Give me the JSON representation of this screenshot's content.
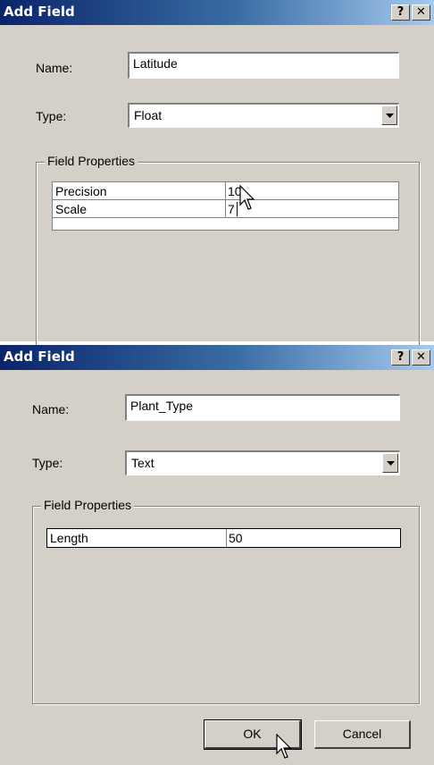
{
  "dialogs": [
    {
      "title": "Add Field",
      "help_label": "?",
      "close_label": "✕",
      "name_label": "Name:",
      "name_value": "Latitude",
      "type_label": "Type:",
      "type_value": "Float",
      "group_title": "Field Properties",
      "properties": [
        {
          "name": "Precision",
          "value": "10"
        },
        {
          "name": "Scale",
          "value": "7"
        }
      ]
    },
    {
      "title": "Add Field",
      "help_label": "?",
      "close_label": "✕",
      "name_label": "Name:",
      "name_value": "Plant_Type",
      "type_label": "Type:",
      "type_value": "Text",
      "group_title": "Field Properties",
      "properties": [
        {
          "name": "Length",
          "value": "50"
        }
      ],
      "ok_label": "OK",
      "cancel_label": "Cancel"
    }
  ],
  "icons": {
    "mouse_cursor": "arrow-pointer-icon",
    "combo_arrow": "chevron-down-icon"
  }
}
